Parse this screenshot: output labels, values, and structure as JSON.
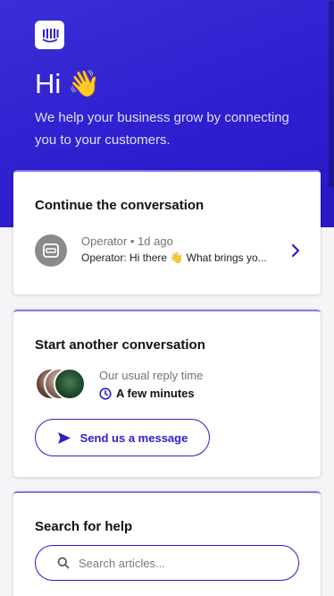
{
  "header": {
    "greeting": "Hi",
    "wave_emoji": "👋",
    "tagline": "We help your business grow by connecting you to your customers.",
    "logo_icon": "intercom-logo-icon",
    "bg_color": "#2e1fd0"
  },
  "continue_card": {
    "title": "Continue the conversation",
    "sender": "Operator",
    "time": "1d ago",
    "meta": "Operator • 1d ago",
    "preview": "Operator: Hi there 👋 What brings yo...",
    "avatar_icon": "operator-icon",
    "chevron_icon": "chevron-right-icon"
  },
  "start_card": {
    "title": "Start another conversation",
    "reply_label": "Our usual reply time",
    "reply_time": "A few minutes",
    "clock_icon": "clock-icon",
    "button_label": "Send us a message",
    "send_icon": "send-icon",
    "accent": "#2c1ec9"
  },
  "help_card": {
    "title": "Search for help",
    "search_placeholder": "Search articles...",
    "search_icon": "search-icon"
  }
}
